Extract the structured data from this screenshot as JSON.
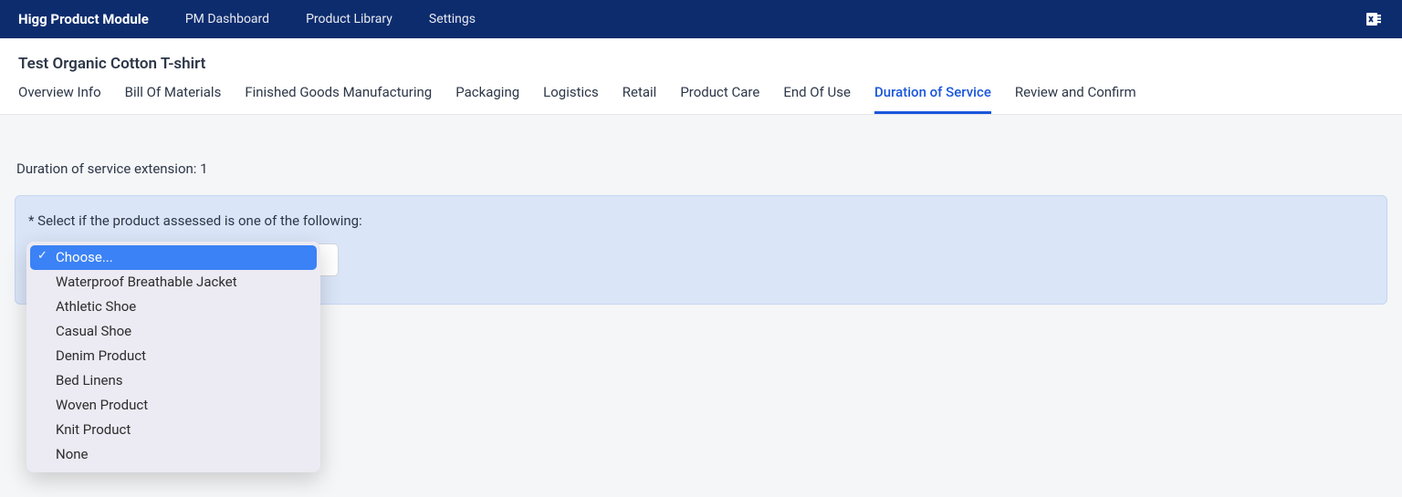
{
  "topNav": {
    "brand": "Higg Product Module",
    "links": [
      "PM Dashboard",
      "Product Library",
      "Settings"
    ]
  },
  "pageTitle": "Test Organic Cotton T-shirt",
  "tabs": [
    {
      "label": "Overview Info",
      "active": false
    },
    {
      "label": "Bill Of Materials",
      "active": false
    },
    {
      "label": "Finished Goods Manufacturing",
      "active": false
    },
    {
      "label": "Packaging",
      "active": false
    },
    {
      "label": "Logistics",
      "active": false
    },
    {
      "label": "Retail",
      "active": false
    },
    {
      "label": "Product Care",
      "active": false
    },
    {
      "label": "End Of Use",
      "active": false
    },
    {
      "label": "Duration of Service",
      "active": true
    },
    {
      "label": "Review and Confirm",
      "active": false
    }
  ],
  "section": {
    "label": "Duration of service extension: 1"
  },
  "panel": {
    "question": "* Select if the product assessed is one of the following:",
    "select": {
      "placeholder": "Choose...",
      "options": [
        {
          "label": "Choose...",
          "selected": true
        },
        {
          "label": "Waterproof Breathable Jacket",
          "selected": false
        },
        {
          "label": "Athletic Shoe",
          "selected": false
        },
        {
          "label": "Casual Shoe",
          "selected": false
        },
        {
          "label": "Denim Product",
          "selected": false
        },
        {
          "label": "Bed Linens",
          "selected": false
        },
        {
          "label": "Woven Product",
          "selected": false
        },
        {
          "label": "Knit Product",
          "selected": false
        },
        {
          "label": "None",
          "selected": false
        }
      ]
    }
  }
}
